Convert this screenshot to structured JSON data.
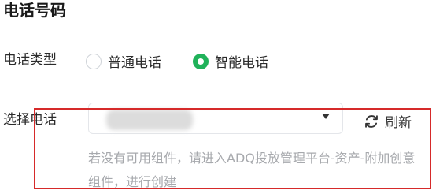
{
  "section": {
    "title": "电话号码"
  },
  "phone_type": {
    "label": "电话类型",
    "options": [
      {
        "label": "普通电话",
        "selected": false
      },
      {
        "label": "智能电话",
        "selected": true
      }
    ],
    "accent_color": "#20b25a"
  },
  "select_phone": {
    "label": "选择电话",
    "value": "",
    "refresh_label": "刷新",
    "hint": "若没有可用组件，请进入ADQ投放管理平台-资产-附加创意组件，进行创建"
  },
  "highlight_color": "#d62a2a"
}
